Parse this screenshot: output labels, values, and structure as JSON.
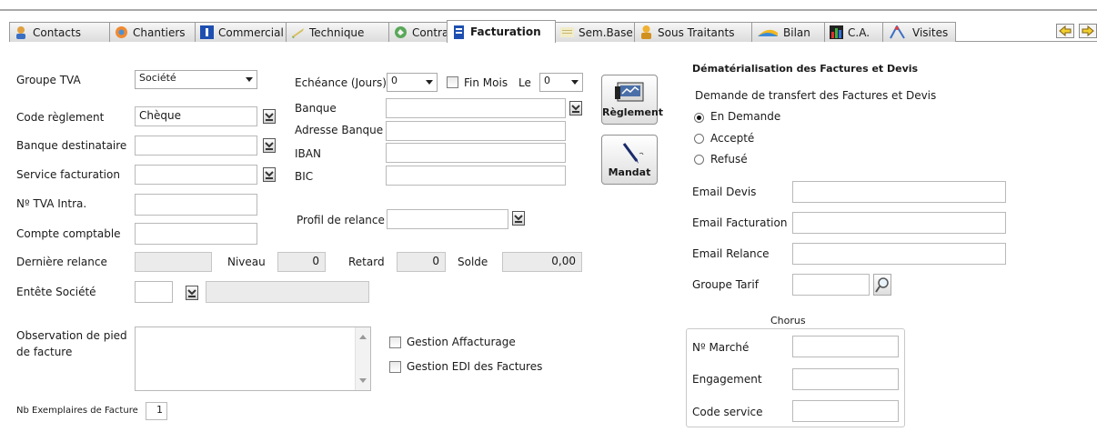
{
  "tabs": [
    {
      "label": "Contacts",
      "icon": "contacts-icon"
    },
    {
      "label": "Chantiers",
      "icon": "chantiers-icon"
    },
    {
      "label": "Commercial",
      "icon": "commercial-icon"
    },
    {
      "label": "Technique",
      "icon": "technique-icon"
    },
    {
      "label": "Contrats",
      "icon": "contrats-icon"
    },
    {
      "label": "Facturation",
      "icon": "facturation-icon",
      "active": true
    },
    {
      "label": "Sem.Base",
      "icon": "sembase-icon"
    },
    {
      "label": "Sous Traitants",
      "icon": "sous-traitants-icon"
    },
    {
      "label": "Bilan",
      "icon": "bilan-icon"
    },
    {
      "label": "C.A.",
      "icon": "ca-icon"
    },
    {
      "label": "Visites",
      "icon": "visites-icon"
    }
  ],
  "left": {
    "groupe_tva": {
      "label": "Groupe TVA",
      "value": "Société"
    },
    "code_reglement": {
      "label": "Code règlement",
      "value": "Chèque"
    },
    "banque_destinataire": {
      "label": "Banque destinataire",
      "value": ""
    },
    "service_facturation": {
      "label": "Service facturation",
      "value": ""
    },
    "tva_intra": {
      "label": "Nº TVA Intra.",
      "value": ""
    },
    "compte_comptable": {
      "label": "Compte comptable",
      "value": ""
    },
    "derniere_relance": {
      "label": "Dernière relance",
      "value": ""
    },
    "niveau": {
      "label": "Niveau",
      "value": "0"
    },
    "retard": {
      "label": "Retard",
      "value": "0"
    },
    "solde": {
      "label": "Solde",
      "value": "0,00"
    },
    "entete_societe": {
      "label": "Entête Société",
      "code": "",
      "name": ""
    },
    "observation": {
      "label_line1": "Observation de pied",
      "label_line2": "de facture",
      "value": ""
    },
    "nb_exemplaires": {
      "label": "Nb Exemplaires de Facture",
      "value": "1"
    }
  },
  "middle": {
    "echeance": {
      "label": "Echéance (Jours)",
      "value": "0"
    },
    "fin_mois": {
      "label": "Fin Mois",
      "checked": false
    },
    "le": {
      "label": "Le",
      "value": "0"
    },
    "banque": {
      "label": "Banque",
      "value": ""
    },
    "adresse_banque": {
      "label": "Adresse Banque",
      "value": ""
    },
    "iban": {
      "label": "IBAN",
      "value": ""
    },
    "bic": {
      "label": "BIC",
      "value": ""
    },
    "profil_relance": {
      "label": "Profil de relance",
      "value": ""
    },
    "gestion_affacturage": {
      "label": "Gestion Affacturage",
      "checked": false
    },
    "gestion_edi": {
      "label": "Gestion EDI des Factures",
      "checked": false
    }
  },
  "buttons": {
    "reglement": "Règlement",
    "mandat": "Mandat"
  },
  "right": {
    "dematerialisation_title": "Dématérialisation des Factures et Devis",
    "demande_title": "Demande de transfert des Factures et Devis",
    "radio_options": [
      {
        "label": "En Demande",
        "checked": true
      },
      {
        "label": "Accepté",
        "checked": false
      },
      {
        "label": "Refusé",
        "checked": false
      }
    ],
    "email_devis": {
      "label": "Email Devis",
      "value": ""
    },
    "email_facturation": {
      "label": "Email Facturation",
      "value": ""
    },
    "email_relance": {
      "label": "Email Relance",
      "value": ""
    },
    "groupe_tarif": {
      "label": "Groupe Tarif",
      "value": ""
    },
    "chorus": {
      "title": "Chorus",
      "marche": {
        "label": "Nº Marché",
        "value": ""
      },
      "engagement": {
        "label": "Engagement",
        "value": ""
      },
      "code_service": {
        "label": "Code service",
        "value": ""
      }
    }
  }
}
